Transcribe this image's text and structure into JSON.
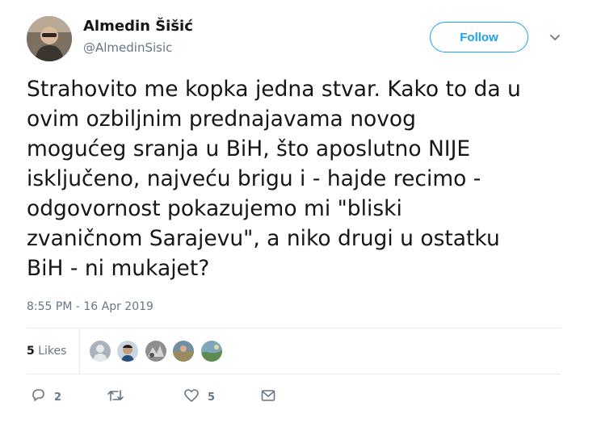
{
  "author": {
    "name": "Almedin Šišić",
    "handle": "@AlmedinSisic"
  },
  "follow_label": "Follow",
  "tweet_text": "Strahovito me kopka jedna stvar. Kako to da u\novim ozbiljnim prednajavama novog\nmogućeg sranja u BiH, što aposlutno NIJE\nisključeno, najveću brigu i - hajde recimo -\nodgovornost pokazujemo mi \"bliski\nzvaničnom Sarajevu\", a niko drugi u ostatku\nBiH - ni mukajet?",
  "timestamp": "8:55 PM - 16 Apr 2019",
  "likes": {
    "count": "5",
    "label": "Likes"
  },
  "actions": {
    "replies": "2",
    "likes": "5"
  },
  "colors": {
    "accent": "#1da1f2",
    "muted": "#657786",
    "divider": "#e6ecf0"
  },
  "icons": [
    "chevron-down-icon",
    "reply-icon",
    "retweet-icon",
    "heart-icon",
    "message-icon"
  ]
}
